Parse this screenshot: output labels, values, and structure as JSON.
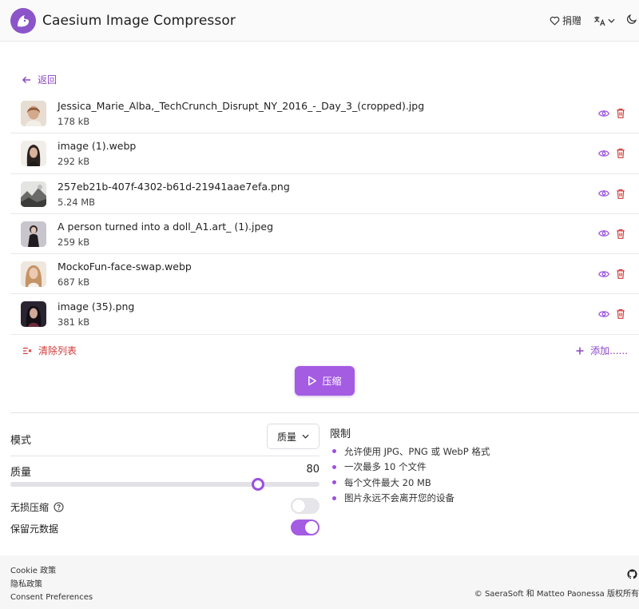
{
  "app": {
    "title": "Caesium Image Compressor",
    "donate_label": "捐赠",
    "colors": {
      "accent": "#a45ce3",
      "accent_text": "#8b45c9",
      "danger": "#d03a3a"
    }
  },
  "nav": {
    "back_label": "返回"
  },
  "files": [
    {
      "name": "Jessica_Marie_Alba,_TechCrunch_Disrupt_NY_2016_-_Day_3_(cropped).jpg",
      "size": "178 kB"
    },
    {
      "name": "image (1).webp",
      "size": "292 kB"
    },
    {
      "name": "257eb21b-407f-4302-b61d-21941aae7efa.png",
      "size": "5.24 MB"
    },
    {
      "name": "A person turned into a doll_A1.art_ (1).jpeg",
      "size": "259 kB"
    },
    {
      "name": "MockoFun-face-swap.webp",
      "size": "687 kB"
    },
    {
      "name": "image (35).png",
      "size": "381 kB"
    }
  ],
  "list_actions": {
    "clear_label": "清除列表",
    "add_label": "添加......"
  },
  "compress_label": "压缩",
  "settings": {
    "mode_label": "模式",
    "mode_value": "质量",
    "quality_label": "质量",
    "quality_value": "80",
    "quality_slider_percent": 80,
    "lossless_label": "无损压缩",
    "lossless_on": false,
    "keep_metadata_label": "保留元数据",
    "keep_metadata_on": true
  },
  "limits": {
    "title": "限制",
    "items": [
      "允许使用 JPG、PNG 或 WebP 格式",
      "一次最多 10 个文件",
      "每个文件最大 20 MB",
      "图片永远不会离开您的设备"
    ]
  },
  "footer": {
    "links": [
      "Cookie 政策",
      "隐私政策",
      "Consent Preferences"
    ],
    "copyright": "© SaeraSoft 和 Matteo Paonessa 版权所有"
  }
}
